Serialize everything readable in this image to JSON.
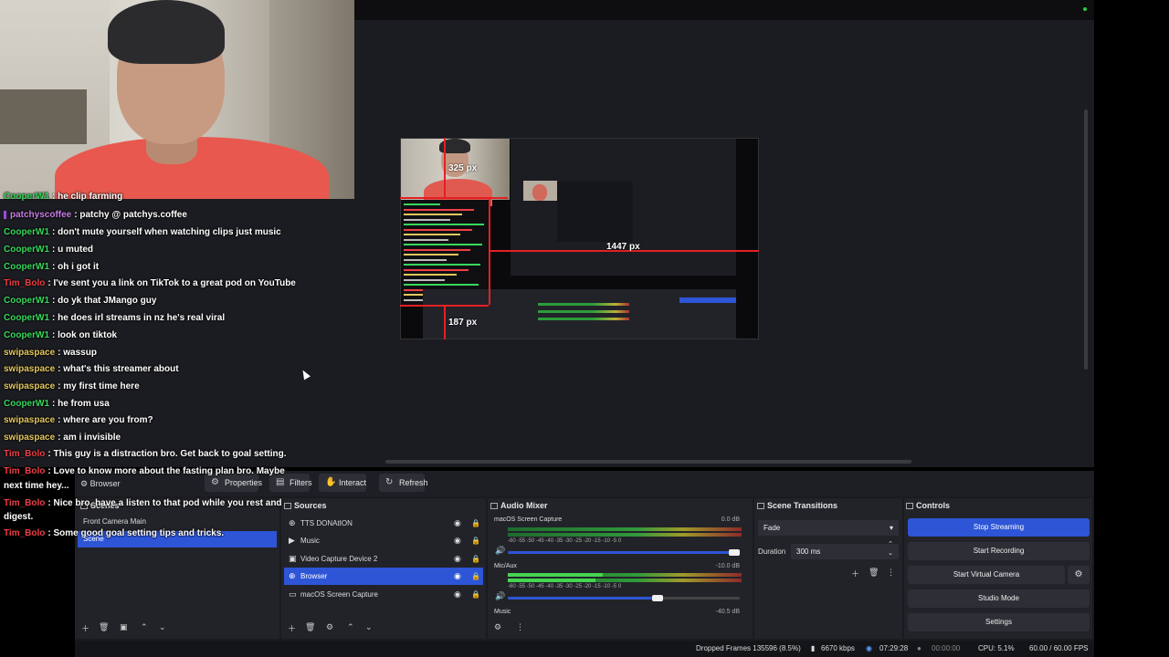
{
  "chat": [
    {
      "user": "CooperW1",
      "msg": ": he clip farming",
      "color": "cooper"
    },
    {
      "user": "patchyscoffee",
      "msg": ": patchy @ patchys.coffee",
      "color": "patchy"
    },
    {
      "user": "CooperW1",
      "msg": ": don't mute yourself when watching clips just music",
      "color": "cooper"
    },
    {
      "user": "CooperW1",
      "msg": ": u muted",
      "color": "cooper"
    },
    {
      "user": "CooperW1",
      "msg": ": oh i got it",
      "color": "cooper"
    },
    {
      "user": "Tim_Bolo",
      "msg": ": I've sent you a link on TikTok to a great pod on YouTube",
      "color": "tim"
    },
    {
      "user": "CooperW1",
      "msg": ": do yk that JMango guy",
      "color": "cooper"
    },
    {
      "user": "CooperW1",
      "msg": ": he does irl streams in nz he's real viral",
      "color": "cooper"
    },
    {
      "user": "CooperW1",
      "msg": ": look on tiktok",
      "color": "cooper"
    },
    {
      "user": "swipaspace",
      "msg": ": wassup",
      "color": "swipa"
    },
    {
      "user": "swipaspace",
      "msg": ": what's this streamer about",
      "color": "swipa"
    },
    {
      "user": "swipaspace",
      "msg": ": my first time here",
      "color": "swipa"
    },
    {
      "user": "CooperW1",
      "msg": ": he from usa",
      "color": "cooper"
    },
    {
      "user": "swipaspace",
      "msg": ": where are you from?",
      "color": "swipa"
    },
    {
      "user": "swipaspace",
      "msg": ": am i invisible",
      "color": "swipa"
    },
    {
      "user": "Tim_Bolo",
      "msg": ": This guy is a distraction bro. Get back to goal setting.",
      "color": "tim"
    },
    {
      "user": "Tim_Bolo",
      "msg": ": Love to know more about the fasting plan bro. Maybe",
      "color": "tim"
    },
    {
      "user": "",
      "msg": "next time hey...",
      "color": "none"
    },
    {
      "user": "Tim_Bolo",
      "msg": ": Nice bro, have a listen to that pod while you rest and",
      "color": "tim"
    },
    {
      "user": "",
      "msg": "digest.",
      "color": "none"
    },
    {
      "user": "Tim_Bolo",
      "msg": ": Some good goal setting tips and tricks.",
      "color": "tim"
    }
  ],
  "measurements": {
    "top": "325 px",
    "right": "1447 px",
    "bottom": "187 px"
  },
  "source_toolbar": {
    "selected_source": "Browser",
    "properties": "Properties",
    "filters": "Filters",
    "interact": "Interact",
    "refresh": "Refresh"
  },
  "scenes": {
    "title": "Scenes",
    "items": [
      "Front Camera Main",
      "Scene"
    ],
    "selected_index": 1
  },
  "sources": {
    "title": "Sources",
    "items": [
      {
        "label": "TTS DONAtION",
        "icon": "browser-icon",
        "selected": false
      },
      {
        "label": "Music",
        "icon": "play-icon",
        "selected": false
      },
      {
        "label": "Video Capture Device 2",
        "icon": "camera-icon",
        "selected": false
      },
      {
        "label": "Browser",
        "icon": "browser-icon",
        "selected": true
      },
      {
        "label": "macOS Screen Capture",
        "icon": "display-icon",
        "selected": false
      }
    ]
  },
  "audio_mixer": {
    "title": "Audio Mixer",
    "channels": [
      {
        "name": "macOS Screen Capture",
        "db": "0.0 dB"
      },
      {
        "name": "Mic/Aux",
        "db": "-10.0 dB"
      },
      {
        "name": "Music",
        "db": "-40.5 dB"
      }
    ],
    "scale": "-60  -55  -50  -45  -40  -35  -30  -25  -20  -15  -10  -5  0"
  },
  "scene_transitions": {
    "title": "Scene Transitions",
    "transition": "Fade",
    "duration_label": "Duration",
    "duration_value": "300 ms"
  },
  "controls": {
    "title": "Controls",
    "stop_streaming": "Stop Streaming",
    "start_recording": "Start Recording",
    "start_virtual_camera": "Start Virtual Camera",
    "studio_mode": "Studio Mode",
    "settings": "Settings"
  },
  "status_bar": {
    "dropped_frames": "Dropped Frames 135596 (8.5%)",
    "bitrate": "6670 kbps",
    "stream_time": "07:29:28",
    "record_time": "00:00:00",
    "cpu": "CPU: 5.1%",
    "fps": "60.00 / 60.00 FPS"
  },
  "colors": {
    "accent": "#2d55d6",
    "panel": "#222328",
    "background": "#1b1c21"
  }
}
